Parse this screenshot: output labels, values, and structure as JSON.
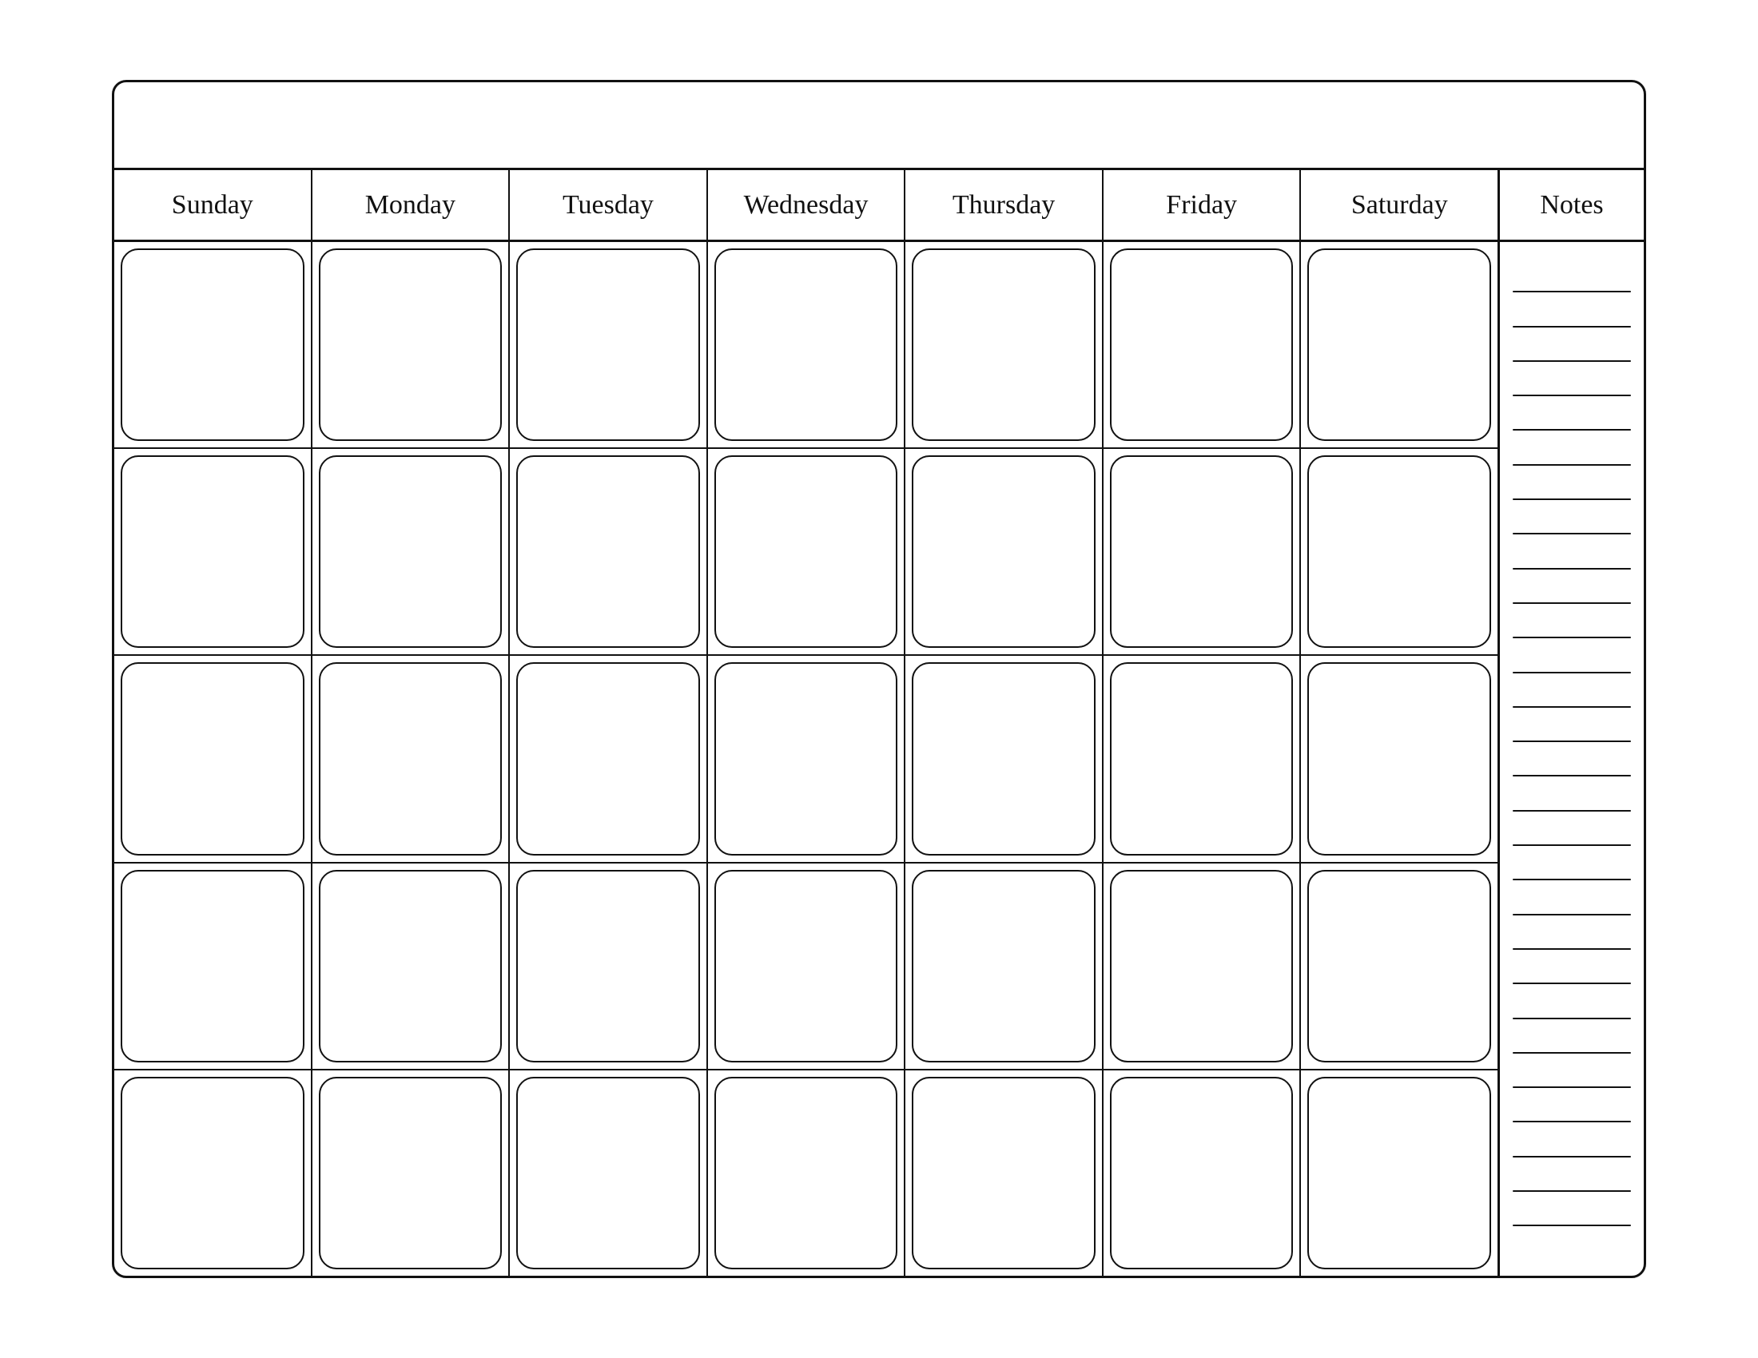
{
  "calendar": {
    "title": "",
    "days": [
      "Sunday",
      "Monday",
      "Tuesday",
      "Wednesday",
      "Thursday",
      "Friday",
      "Saturday"
    ],
    "notes_label": "Notes",
    "rows": 5,
    "notes_line_count": 28
  }
}
